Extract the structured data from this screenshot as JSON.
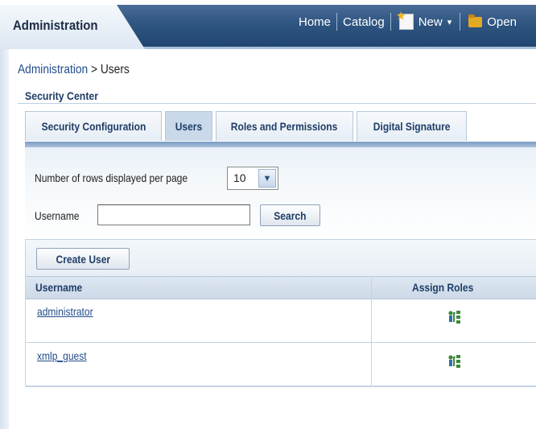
{
  "header": {
    "app_title": "Administration",
    "nav": {
      "home": "Home",
      "catalog": "Catalog",
      "new": "New",
      "open": "Open"
    }
  },
  "breadcrumb": {
    "parent": "Administration",
    "separator": " > ",
    "current": "Users"
  },
  "section_title": "Security Center",
  "tabs": [
    {
      "label": "Security Configuration",
      "active": false
    },
    {
      "label": "Users",
      "active": true
    },
    {
      "label": "Roles and Permissions",
      "active": false
    },
    {
      "label": "Digital Signature",
      "active": false
    }
  ],
  "form": {
    "rows_label": "Number of rows displayed per page",
    "rows_value": "10",
    "username_label": "Username",
    "username_value": "",
    "search_button": "Search"
  },
  "table": {
    "create_user_button": "Create User",
    "columns": [
      "Username",
      "Assign Roles"
    ],
    "rows": [
      {
        "username": "administrator",
        "roles_icon": "assign-roles-icon"
      },
      {
        "username": "xmlp_guest",
        "roles_icon": "assign-roles-icon"
      }
    ]
  },
  "colors": {
    "header_band": "#2f5581",
    "link": "#234d8c",
    "heading": "#1f3d66",
    "tab_active": "#c9d9ea"
  }
}
